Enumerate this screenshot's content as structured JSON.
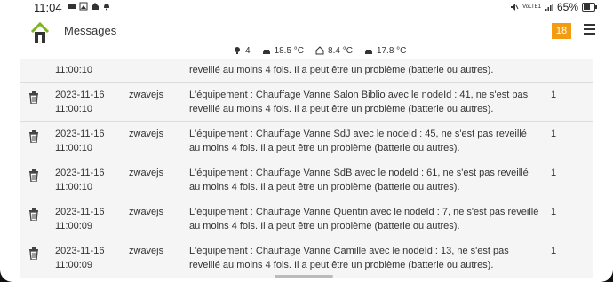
{
  "status_bar": {
    "time": "11:04",
    "network": "VoLTE1",
    "battery": "65%"
  },
  "header": {
    "title": "Messages",
    "badge_count": "18"
  },
  "weather": [
    {
      "icon": "lightbulb-icon",
      "value": "4"
    },
    {
      "icon": "car-icon",
      "value": "18.5 °C"
    },
    {
      "icon": "house-outline-icon",
      "value": "8.4 °C"
    },
    {
      "icon": "car-icon",
      "value": "17.8 °C"
    }
  ],
  "messages": [
    {
      "date": "",
      "time": "11:00:10",
      "source": "",
      "text_line1": "reveillé au moins 4 fois. Il a peut être un problème (batterie ou autres).",
      "text_line2": "",
      "count": ""
    },
    {
      "date": "2023-11-16",
      "time": "11:00:10",
      "source": "zwavejs",
      "text_line1": "L'équipement : Chauffage Vanne Salon Biblio avec le nodeId : 41, ne s'est pas",
      "text_line2": "reveillé au moins 4 fois. Il a peut être un problème (batterie ou autres).",
      "count": "1"
    },
    {
      "date": "2023-11-16",
      "time": "11:00:10",
      "source": "zwavejs",
      "text_line1": "L'équipement : Chauffage Vanne SdJ avec le nodeId : 45, ne s'est pas reveillé",
      "text_line2": "au moins 4 fois. Il a peut être un problème (batterie ou autres).",
      "count": "1"
    },
    {
      "date": "2023-11-16",
      "time": "11:00:10",
      "source": "zwavejs",
      "text_line1": "L'équipement : Chauffage Vanne SdB avec le nodeId : 61, ne s'est pas reveillé",
      "text_line2": "au moins 4 fois. Il a peut être un problème (batterie ou autres).",
      "count": "1"
    },
    {
      "date": "2023-11-16",
      "time": "11:00:09",
      "source": "zwavejs",
      "text_line1": "L'équipement : Chauffage Vanne Quentin avec le nodeId : 7, ne s'est pas reveillé",
      "text_line2": "au moins 4 fois. Il a peut être un problème (batterie ou autres).",
      "count": "1"
    },
    {
      "date": "2023-11-16",
      "time": "11:00:09",
      "source": "zwavejs",
      "text_line1": "L'équipement : Chauffage Vanne Camille avec le nodeId : 13, ne s'est pas",
      "text_line2": "reveillé au moins 4 fois. Il a peut être un problème (batterie ou autres).",
      "count": "1"
    }
  ],
  "colors": {
    "badge": "#f39c12",
    "logo_green": "#7ab51d"
  }
}
